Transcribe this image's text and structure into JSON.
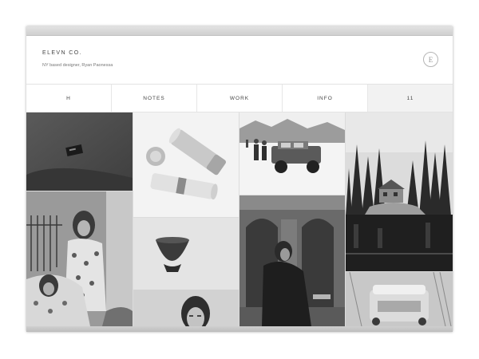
{
  "header": {
    "brand": "ELEVN CO.",
    "tagline": "NY based designer, Ryan Paonessa",
    "logo_letter": "E"
  },
  "nav": {
    "items": [
      {
        "label": "H"
      },
      {
        "label": "NOTES"
      },
      {
        "label": "WORK"
      },
      {
        "label": "INFO"
      },
      {
        "label": "11"
      }
    ]
  },
  "colors": {
    "background": "#ffffff",
    "nav_active": "#f2f2f2",
    "text": "#444444"
  }
}
